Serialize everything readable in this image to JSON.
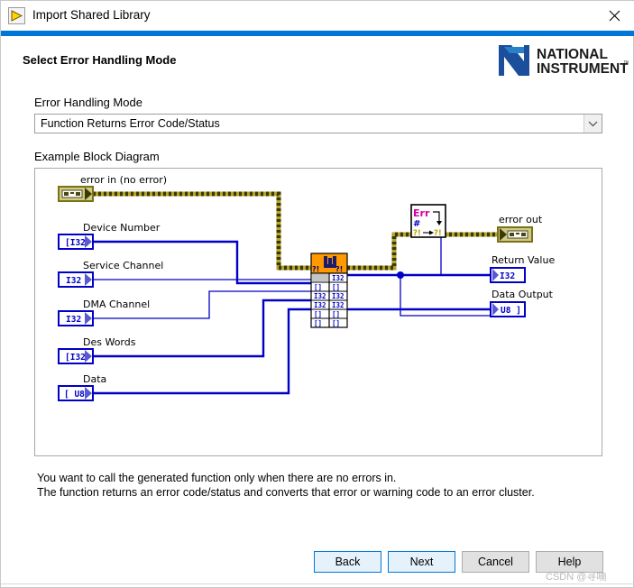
{
  "window": {
    "title": "Import Shared Library",
    "icon": "labview-run-icon",
    "close_label": "✕"
  },
  "header": {
    "page_title": "Select Error Handling Mode",
    "logo_line1": "NATIONAL",
    "logo_line2": "INSTRUMENTS"
  },
  "form": {
    "mode_label": "Error Handling Mode",
    "mode_value": "Function Returns Error Code/Status",
    "mode_options": [
      "Function Returns Error Code/Status"
    ],
    "diagram_label": "Example Block Diagram"
  },
  "diagram": {
    "terminals": [
      {
        "name": "error-in-terminal",
        "label": "error in (no error)",
        "type": "error-cluster",
        "type_text": ""
      },
      {
        "name": "device-number-terminal",
        "label": "Device Number",
        "type": "i32",
        "type_text": "I32"
      },
      {
        "name": "service-channel-terminal",
        "label": "Service Channel",
        "type": "i32",
        "type_text": "I32"
      },
      {
        "name": "dma-channel-terminal",
        "label": "DMA Channel",
        "type": "i32",
        "type_text": "I32"
      },
      {
        "name": "des-words-terminal",
        "label": "Des Words",
        "type": "i32",
        "type_text": "I32"
      },
      {
        "name": "data-terminal",
        "label": "Data",
        "type": "u8-array",
        "type_text": "U8"
      },
      {
        "name": "error-out-terminal",
        "label": "error out",
        "type": "error-cluster",
        "type_text": ""
      },
      {
        "name": "return-value-terminal",
        "label": "Return Value",
        "type": "i32",
        "type_text": "I32"
      },
      {
        "name": "data-output-terminal",
        "label": "Data Output",
        "type": "u8-array",
        "type_text": "U8"
      }
    ],
    "call_library_node": {
      "name": "call-library-function-node",
      "left_ports": [
        "",
        "⎔",
        "I32",
        "I32",
        "⎔",
        "⎔"
      ],
      "right_ports": [
        "I32",
        "⎔",
        "I32",
        "I32",
        "⎔",
        "⎔"
      ],
      "top_left_glyph": "?!",
      "top_right_glyph": "?!"
    },
    "error_node": {
      "name": "simple-error-handler-node",
      "glyph_err": "Err",
      "glyph_hash": "#",
      "glyph_left": "?!",
      "glyph_right": "?!"
    }
  },
  "description": {
    "line1": "You want to call the generated function only when there are no errors in.",
    "line2": "The function returns an error code/status and converts that error or warning code to an error cluster."
  },
  "buttons": {
    "back": "Back",
    "next": "Next",
    "cancel": "Cancel",
    "help": "Help"
  },
  "watermark": "CSDN @寻喃",
  "colors": {
    "accent": "#0076d7",
    "primary_button_bg": "#e5f1fb",
    "wire_blue": "#0000c8",
    "wire_error": "#d9c32a",
    "node_orange": "#ff9900",
    "terminal_border": "#0000c8",
    "error_terminal_border": "#8a8a17"
  }
}
